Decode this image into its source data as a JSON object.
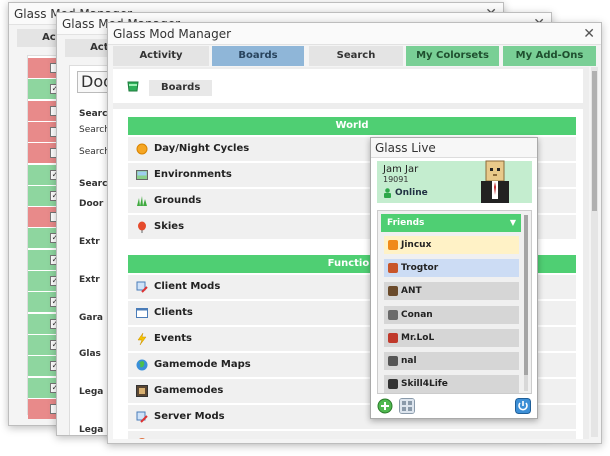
{
  "window_back": {
    "title": "Glass Mod Manager",
    "tab_label": "Acti",
    "rows": [
      "red",
      "green",
      "red",
      "red",
      "red",
      "green",
      "green",
      "red",
      "green",
      "green",
      "green",
      "green",
      "green",
      "green",
      "green",
      "green",
      "red"
    ]
  },
  "window_middle": {
    "title": "Glass Mod Manager",
    "tab_label": "Acti",
    "dropdown_value": "Doo",
    "labels": [
      "Searc",
      "Search",
      "Search",
      "Searc",
      "Door",
      "Extr",
      "Extr",
      "Gara",
      "Glas",
      "Lega",
      "Lega"
    ]
  },
  "window_main": {
    "title": "Glass Mod Manager",
    "tabs": [
      {
        "label": "Activity"
      },
      {
        "label": "Boards"
      },
      {
        "label": "Search"
      },
      {
        "label": "My Colorsets"
      },
      {
        "label": "My Add-Ons"
      }
    ],
    "breadcrumb": "Boards",
    "sections": [
      {
        "title": "World",
        "items": [
          {
            "label": "Day/Night Cycles",
            "icon": "sun-icon"
          },
          {
            "label": "Environments",
            "icon": "picture-icon"
          },
          {
            "label": "Grounds",
            "icon": "grass-icon"
          },
          {
            "label": "Skies",
            "icon": "balloon-icon"
          }
        ]
      },
      {
        "title": "Function",
        "items": [
          {
            "label": "Client Mods",
            "icon": "client-mods-icon"
          },
          {
            "label": "Clients",
            "icon": "window-icon"
          },
          {
            "label": "Events",
            "icon": "lightning-icon"
          },
          {
            "label": "Gamemode Maps",
            "icon": "globe-icon"
          },
          {
            "label": "Gamemodes",
            "icon": "gamemodes-icon"
          },
          {
            "label": "Server Mods",
            "icon": "server-mods-icon"
          }
        ]
      }
    ]
  },
  "glass_live": {
    "title": "Glass Live",
    "user": {
      "name": "Jam Jar",
      "id": "19091",
      "status": "Online"
    },
    "friends_header": "Friends",
    "friends": [
      {
        "name": "Jincux",
        "icon": "flame-icon",
        "highlight": "yellow"
      },
      {
        "name": "Trogtor",
        "icon": "shield-icon",
        "highlight": "blue"
      },
      {
        "name": "ANT",
        "icon": "ant-icon",
        "highlight": "none"
      },
      {
        "name": "Conan",
        "icon": "person-icon",
        "highlight": "none"
      },
      {
        "name": "Mr.LoL",
        "icon": "hourglass-icon",
        "highlight": "none"
      },
      {
        "name": "nal",
        "icon": "robot-icon",
        "highlight": "none"
      },
      {
        "name": "Skill4Life",
        "icon": "terminal-icon",
        "highlight": "none"
      }
    ],
    "buttons": {
      "add": "add-friend-icon",
      "grid": "grid-icon",
      "power": "power-icon"
    }
  },
  "colors": {
    "green": "#4fcf73",
    "boards_tab": "#8fb6d8",
    "online_bg": "#c4edcf",
    "red_row": "#e88a8a",
    "green_row": "#8ed69f"
  }
}
